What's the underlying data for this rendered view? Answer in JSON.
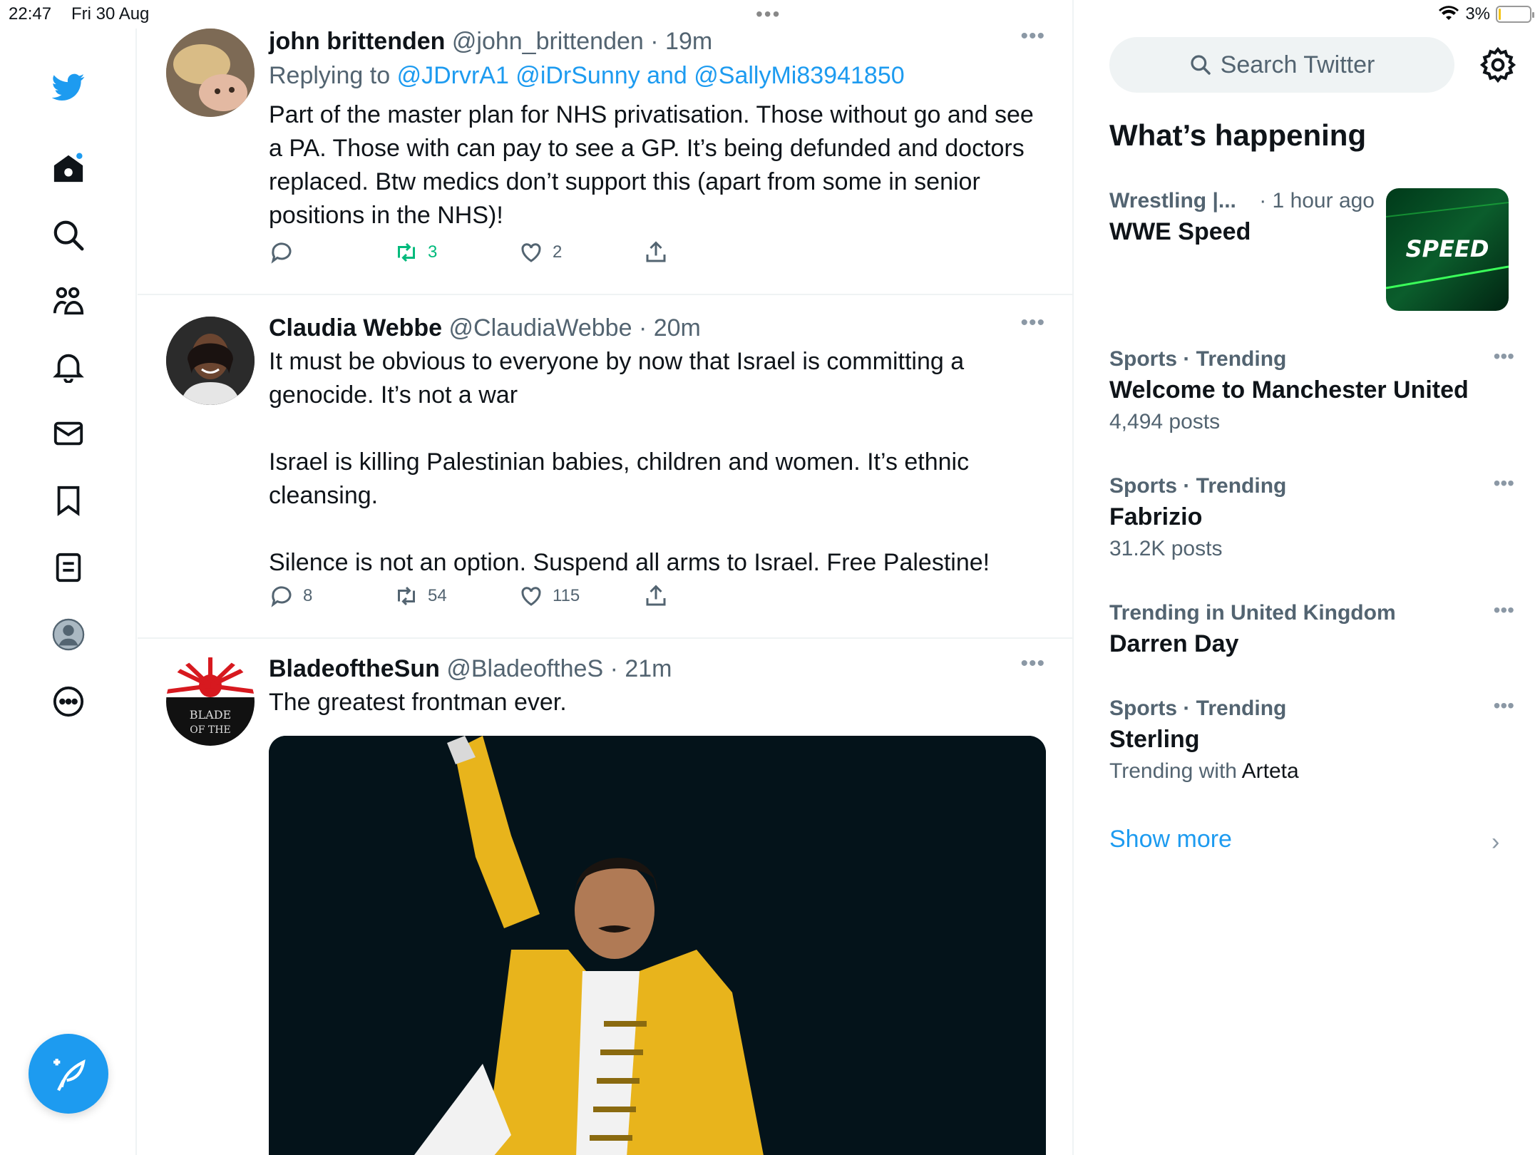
{
  "status_bar": {
    "time": "22:47",
    "date": "Fri 30 Aug",
    "battery": "3%",
    "battery_level": 0.03
  },
  "nav": {
    "items": [
      {
        "icon": "twitter-bird-icon"
      },
      {
        "icon": "home-icon"
      },
      {
        "icon": "search-icon"
      },
      {
        "icon": "communities-icon"
      },
      {
        "icon": "notifications-bell-icon"
      },
      {
        "icon": "messages-envelope-icon"
      },
      {
        "icon": "bookmark-icon"
      },
      {
        "icon": "lists-icon"
      },
      {
        "icon": "profile-avatar-icon"
      },
      {
        "icon": "more-circle-icon"
      }
    ],
    "compose_icon": "compose-feather-icon"
  },
  "feed": {
    "tweets": [
      {
        "name": "john brittenden",
        "handle": "@john_brittenden",
        "time": "· 19m",
        "replying_prefix": "Replying to",
        "replying_to": "@JDrvrA1 @iDrSunny and @SallyMi83941850",
        "text": "Part of the master plan for NHS privatisation. Those without go and see\na PA. Those with can pay to see a GP. It’s being defunded and doctors\nreplaced. Btw medics don’t support this (apart from some in senior\npositions in the NHS)!",
        "replies": "",
        "retweets": "3",
        "likes": "2"
      },
      {
        "name": "Claudia Webbe",
        "handle": "@ClaudiaWebbe",
        "time": "· 20m",
        "text": "It must be obvious to everyone by now that Israel is committing a\ngenocide. It’s not a war\n\nIsrael is killing Palestinian babies, children and women. It’s ethnic\ncleansing.\n\nSilence is not an option. Suspend all arms to Israel. Free Palestine!",
        "replies": "8",
        "retweets": "54",
        "likes": "115"
      },
      {
        "name": "BladeoftheSun",
        "handle": "@BladeoftheS",
        "time": "· 21m",
        "text": "The greatest frontman ever.",
        "avatar_text": "BLADE OF THE"
      }
    ]
  },
  "sidebar": {
    "search_placeholder": "Search Twitter",
    "title": "What’s happening",
    "featured": {
      "category": "Wrestling |...",
      "time": "· 1 hour ago",
      "title": "WWE Speed",
      "thumb_text": "SPEED"
    },
    "trends": [
      {
        "context_bold": "Sports",
        "context": " · Trending",
        "title": "Welcome to Manchester United",
        "count": "4,494 posts"
      },
      {
        "context_bold": "Sports",
        "context": " · Trending",
        "title": "Fabrizio",
        "count": "31.2K posts"
      },
      {
        "context_bold": "Trending in United Kingdom",
        "context": "",
        "title": "Darren Day",
        "count": ""
      },
      {
        "context_bold": "Sports",
        "context": " · Trending",
        "title": "Sterling",
        "count_prefix": "Trending with ",
        "count_strong": "Arteta"
      }
    ],
    "show_more": "Show more"
  },
  "colors": {
    "accent": "#1d9bf0",
    "retweet_green": "#00ba7c",
    "muted": "#536471"
  }
}
